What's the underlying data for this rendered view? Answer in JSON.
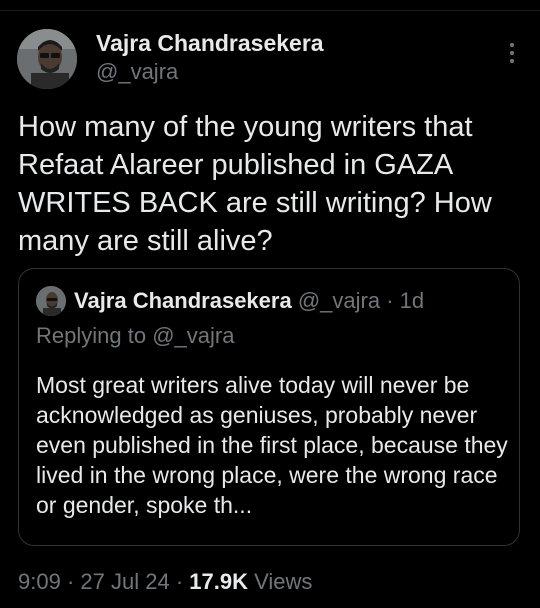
{
  "tweet": {
    "author": {
      "display_name": "Vajra Chandrasekera",
      "handle": "@_vajra"
    },
    "text": "How many of the young writers that Refaat Alareer published in GAZA WRITES BACK are still writing? How many are still alive?",
    "more_icon": "more-vertical-icon"
  },
  "quoted_tweet": {
    "display_name": "Vajra Chandrasekera",
    "handle": "@_vajra",
    "separator": "·",
    "time": "1d",
    "replying_prefix": "Replying to",
    "replying_handle": "@_vajra",
    "text": "Most great writers alive today will never be acknowledged as geniuses, probably never even published in the first place, because they lived in the wrong place, were the wrong race or gender, spoke th..."
  },
  "meta": {
    "time": "9:09",
    "sep1": "·",
    "date": "27 Jul 24",
    "sep2": "·",
    "views_count": "17.9K",
    "views_label": "Views"
  },
  "colors": {
    "background": "#000000",
    "text_primary": "#e7e9ea",
    "text_secondary": "#71767b",
    "border": "#2f3336"
  }
}
